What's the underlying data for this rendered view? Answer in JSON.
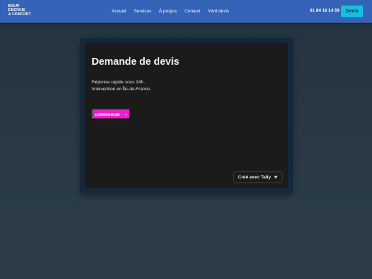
{
  "header": {
    "logo_lines": [
      "BOUR",
      "ÉNERGIE",
      "& CONFORT"
    ],
    "nav": [
      "Accueil",
      "Services",
      "À propos",
      "Contact",
      "Vérif devis"
    ],
    "phone": "01 84 16 14 59",
    "cta_label": "Devis"
  },
  "form": {
    "title": "Demande de devis",
    "desc_lines": [
      "Réponse rapide sous 24h.",
      "Intervention en Île-de-France."
    ],
    "start_label": "commencer",
    "start_icon": "→",
    "badge_label": "Créé avec Tally",
    "badge_icon": "★"
  },
  "colors": {
    "navbar": "#3563b9",
    "cta": "#12c0e4",
    "start_button": "#ec1fd0",
    "card": "#1b1b1b"
  }
}
